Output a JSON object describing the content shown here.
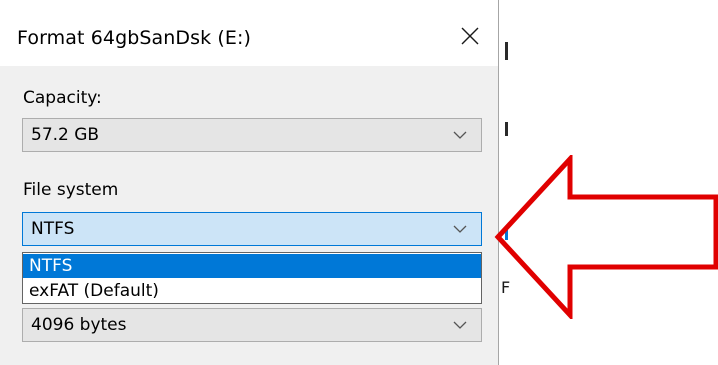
{
  "dialog": {
    "title": "Format 64gbSanDsk (E:)",
    "close_icon": "close-icon"
  },
  "capacity": {
    "label": "Capacity:",
    "value": "57.2 GB"
  },
  "file_system": {
    "label": "File system",
    "value": "NTFS",
    "options": [
      {
        "label": "NTFS",
        "selected": true
      },
      {
        "label": "exFAT (Default)",
        "selected": false
      }
    ]
  },
  "allocation_unit": {
    "value": "4096 bytes"
  },
  "background": {
    "partial_text": "F"
  },
  "annotation": {
    "arrow_icon": "left-arrow-icon",
    "arrow_color": "#e00000"
  },
  "colors": {
    "accent": "#0078d7",
    "active_combo_bg": "#cce4f7",
    "dialog_bg": "#f0f0f0"
  }
}
